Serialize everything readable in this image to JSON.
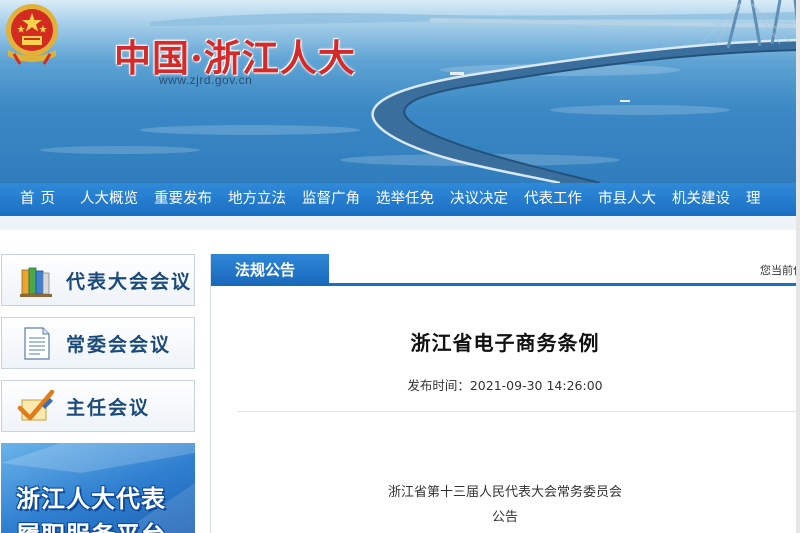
{
  "site": {
    "title": "中国·浙江人大",
    "url": "www.zjrd.gov.cn"
  },
  "nav": {
    "items": [
      "首页",
      "人大概览",
      "重要发布",
      "地方立法",
      "监督广角",
      "选举任免",
      "决议决定",
      "代表工作",
      "市县人大",
      "机关建设",
      "理"
    ]
  },
  "sidebar": {
    "items": [
      {
        "label": "代表大会会议",
        "icon": "books-icon"
      },
      {
        "label": "常委会会议",
        "icon": "document-icon"
      },
      {
        "label": "主任会议",
        "icon": "checkmark-pen-icon"
      }
    ],
    "promo": {
      "line1": "浙江人大代表",
      "line2": "履职服务平台"
    }
  },
  "main": {
    "tab_label": "法规公告",
    "location": "您当前位",
    "article": {
      "title": "浙江省电子商务条例",
      "published": "发布时间：2021-09-30 14:26:00",
      "body": [
        "浙江省第十三届人民代表大会常务委员会",
        "公告"
      ]
    }
  },
  "colors": {
    "nav_blue": "#1b6fc2",
    "title_red": "#d42a2a",
    "sidebar_text": "#1a4a7a"
  }
}
